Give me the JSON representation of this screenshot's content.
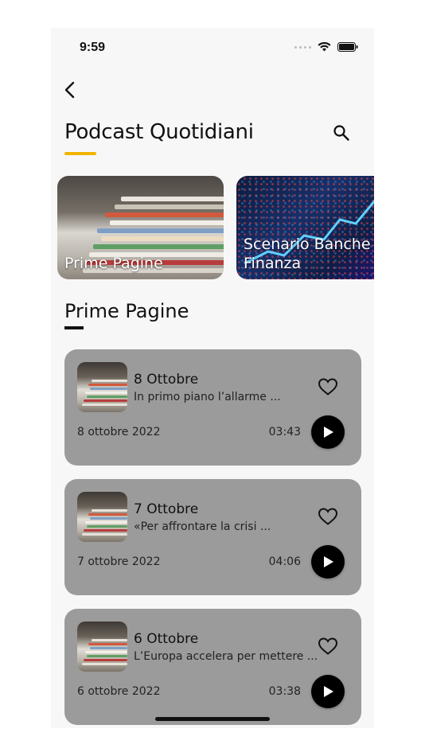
{
  "status": {
    "time": "9:59"
  },
  "header": {
    "title": "Podcast Quotidiani"
  },
  "carousel": [
    {
      "label": "Prime Pagine"
    },
    {
      "label": "Scenario Banche\nFinanza"
    }
  ],
  "section": {
    "title": "Prime Pagine"
  },
  "episodes": [
    {
      "title": "8 Ottobre",
      "desc": "In primo piano l’allarme ...",
      "date": "8 ottobre 2022",
      "duration": "03:43"
    },
    {
      "title": "7 Ottobre",
      "desc": "«Per affrontare la crisi ...",
      "date": "7 ottobre 2022",
      "duration": "04:06"
    },
    {
      "title": "6 Ottobre",
      "desc": "L’Europa accelera per mettere ...",
      "date": "6 ottobre 2022",
      "duration": "03:38"
    }
  ],
  "colors": {
    "accent": "#f1b400",
    "card": "#9b9b9b"
  }
}
